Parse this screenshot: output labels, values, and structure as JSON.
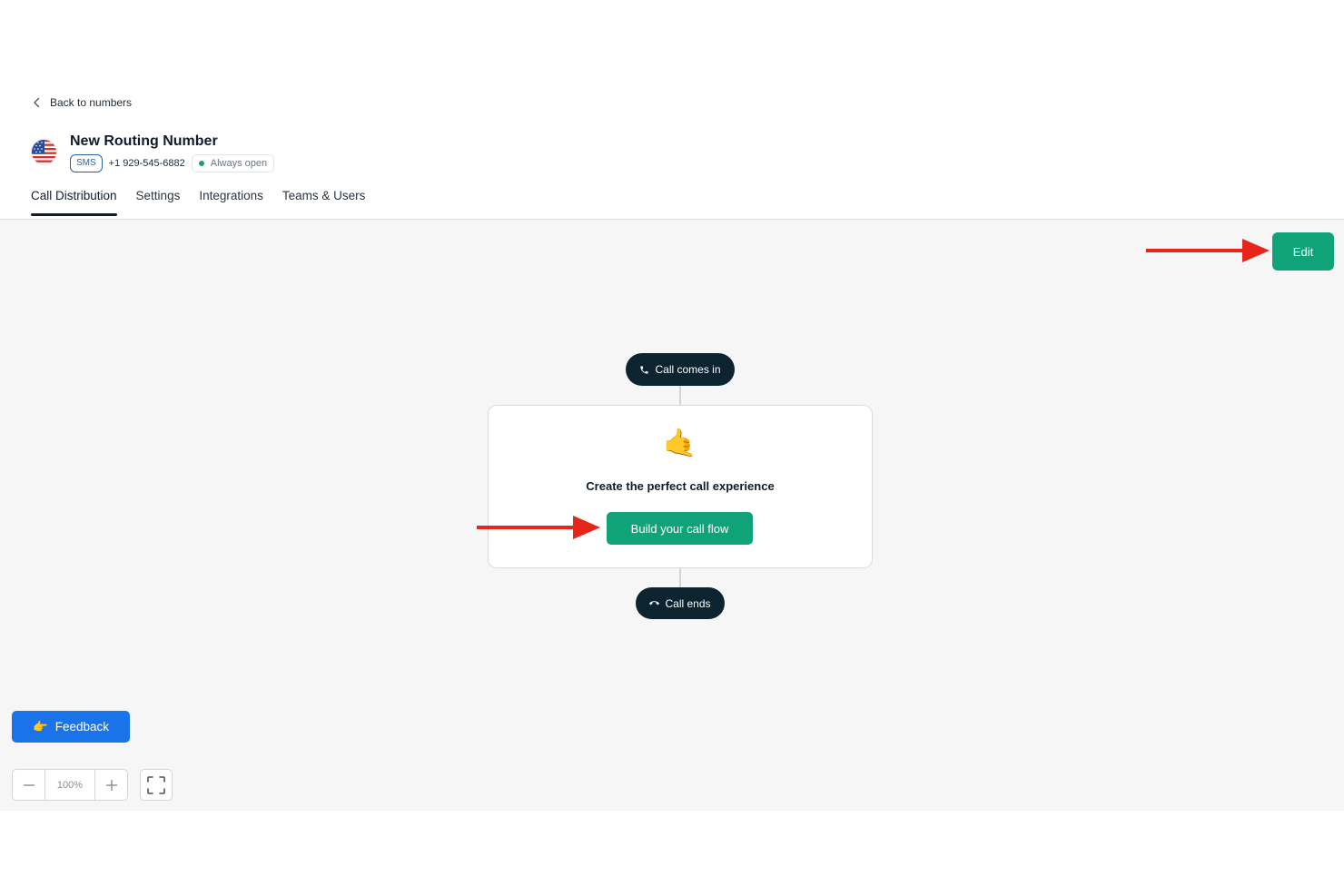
{
  "nav": {
    "back_label": "Back to numbers"
  },
  "number": {
    "title": "New Routing Number",
    "channel_badge": "SMS",
    "phone": "+1 929-545-6882",
    "status": "Always open",
    "flag_icon": "us-flag-icon"
  },
  "tabs": [
    {
      "label": "Call Distribution",
      "active": true
    },
    {
      "label": "Settings",
      "active": false
    },
    {
      "label": "Integrations",
      "active": false
    },
    {
      "label": "Teams & Users",
      "active": false
    }
  ],
  "toolbar": {
    "edit_label": "Edit"
  },
  "flow": {
    "start_label": "Call comes in",
    "start_icon": "phone-icon",
    "end_label": "Call ends",
    "end_icon": "hang-up-icon",
    "card_emoji": "🤙",
    "card_text": "Create the perfect call experience",
    "build_label": "Build your call flow"
  },
  "feedback": {
    "label": "Feedback",
    "emoji": "👉"
  },
  "zoom": {
    "value": "100%",
    "minus": "−",
    "plus": "+"
  },
  "colors": {
    "primary_green": "#10a37a",
    "feedback_blue": "#1a73e8",
    "pill_dark": "#0c2330",
    "annotation_red": "#e8251a",
    "canvas_bg": "#f6f6f6"
  }
}
